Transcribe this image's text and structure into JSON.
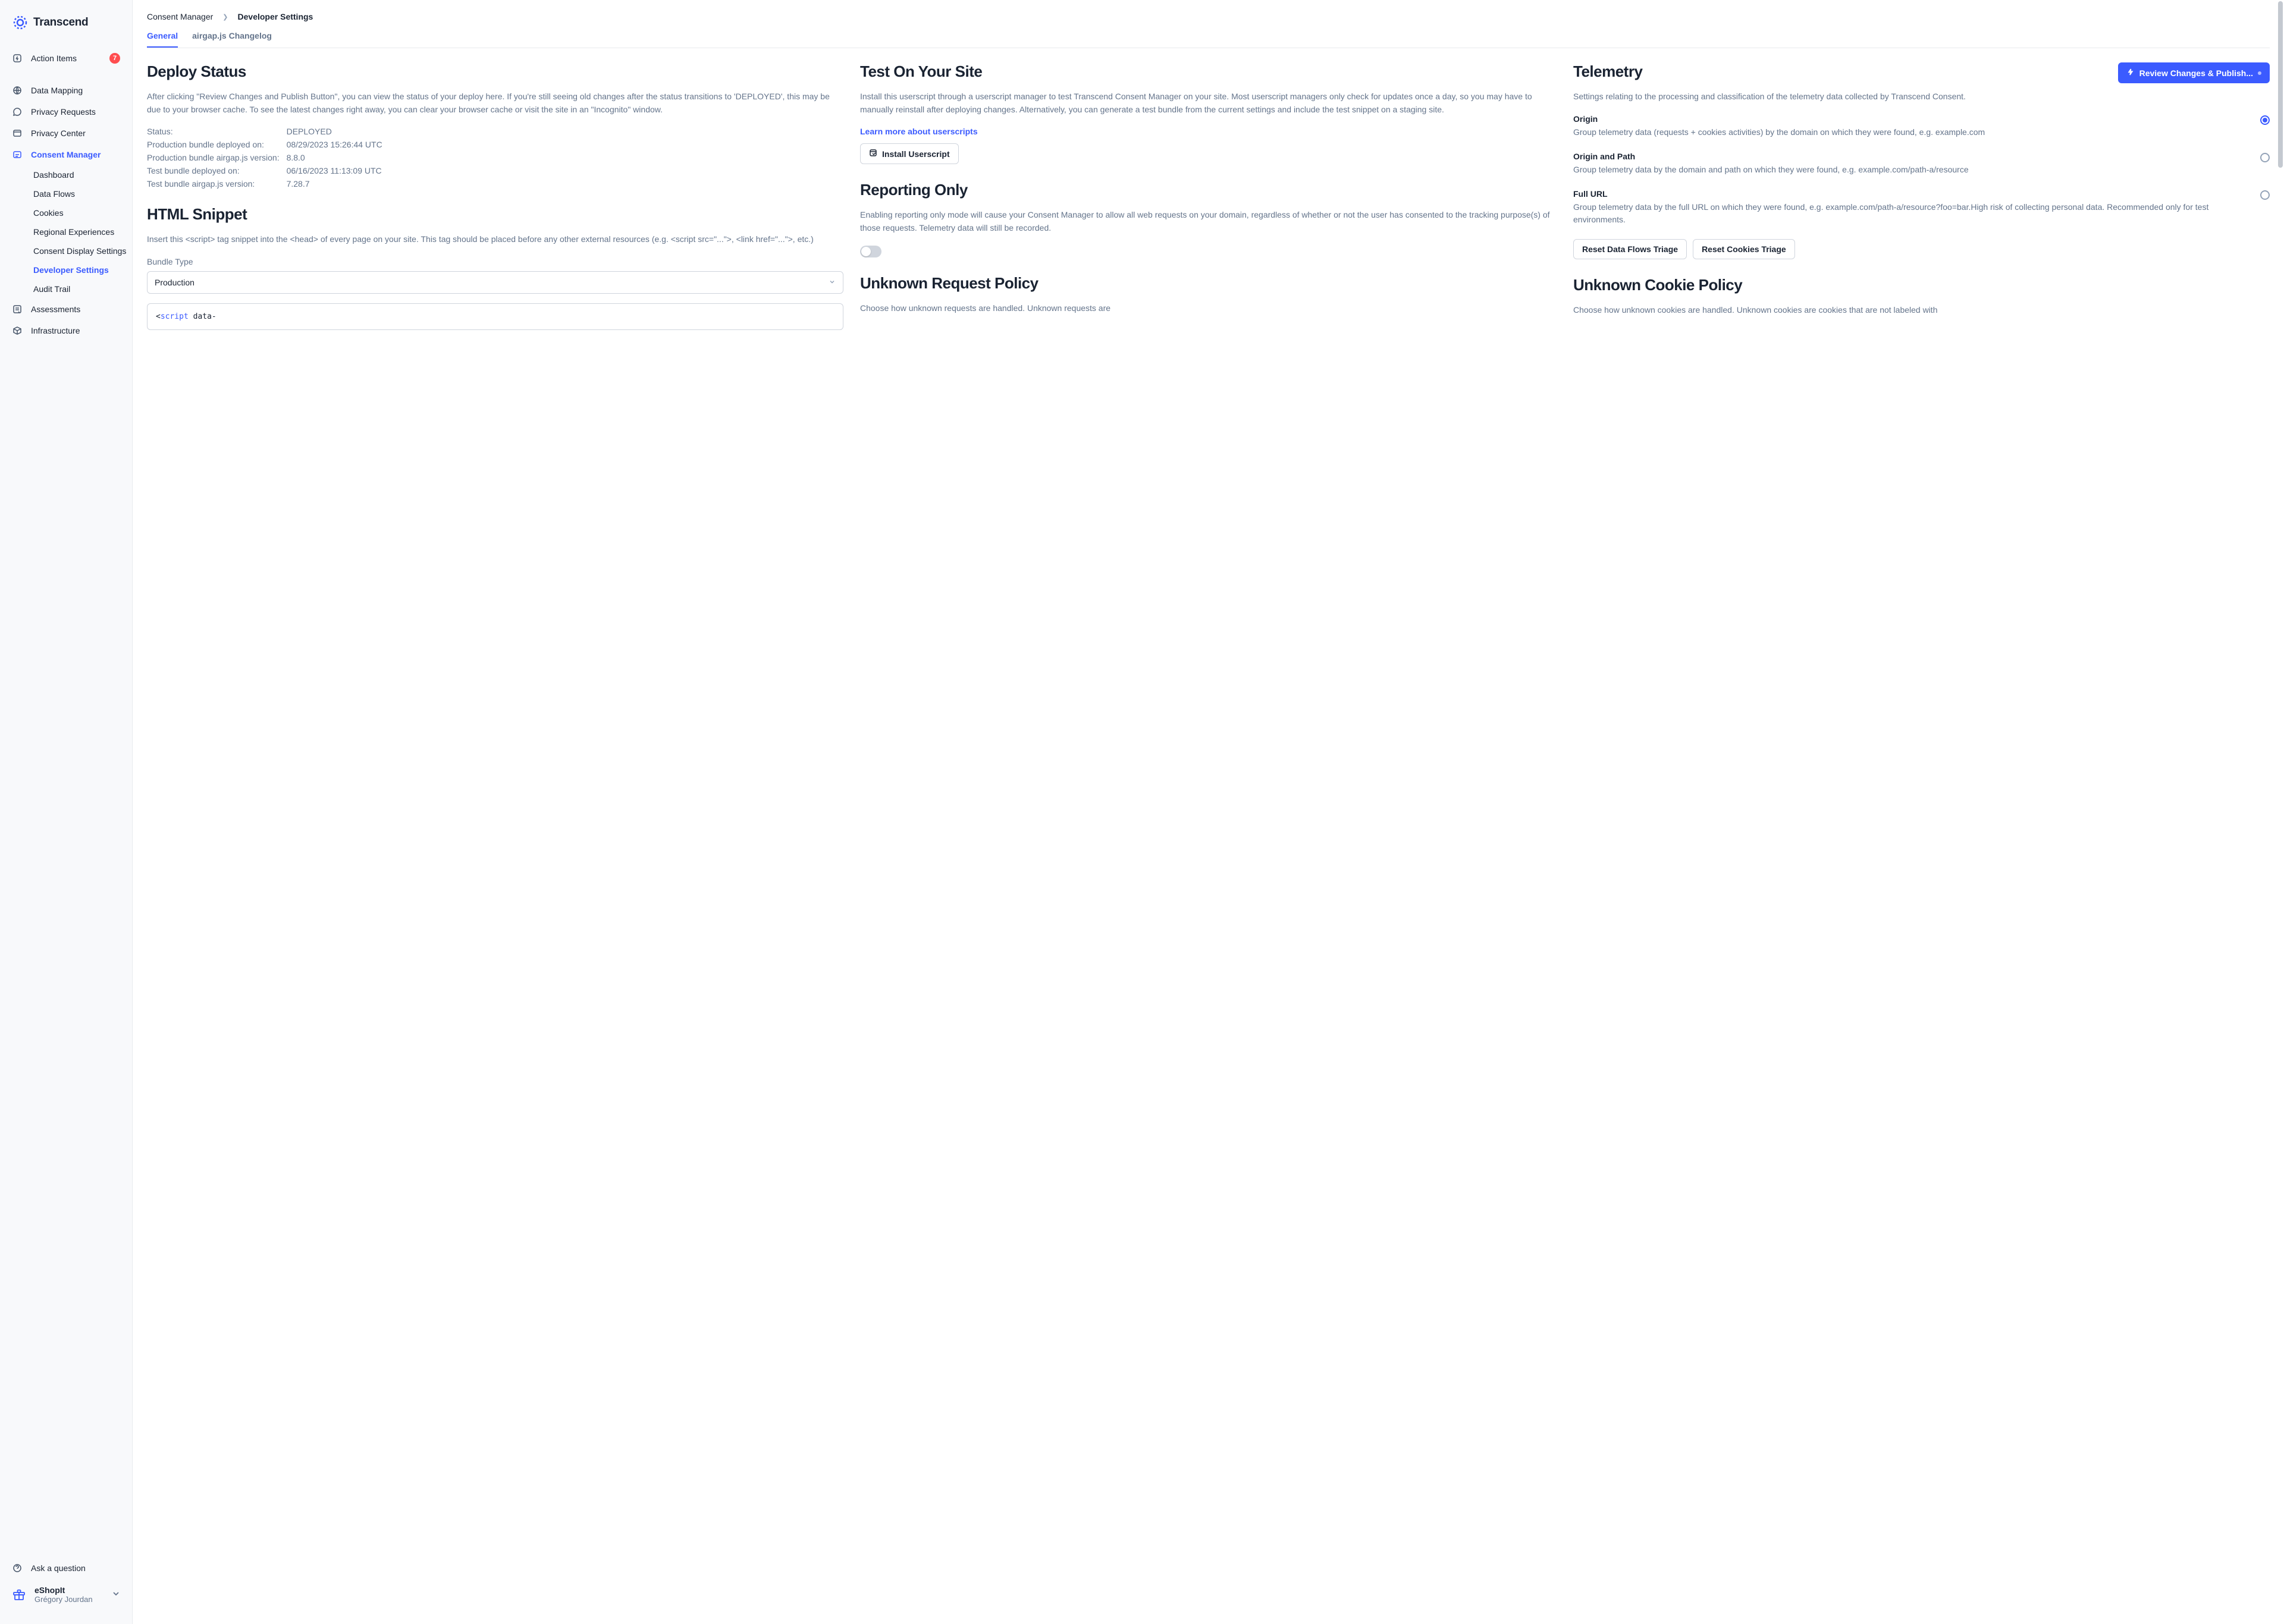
{
  "brand": "Transcend",
  "sidebar": {
    "items": [
      {
        "label": "Action Items",
        "badge": "7"
      },
      {
        "label": "Data Mapping"
      },
      {
        "label": "Privacy Requests"
      },
      {
        "label": "Privacy Center"
      },
      {
        "label": "Consent Manager",
        "active": true
      },
      {
        "label": "Assessments"
      },
      {
        "label": "Infrastructure"
      }
    ],
    "sub": [
      {
        "label": "Dashboard"
      },
      {
        "label": "Data Flows"
      },
      {
        "label": "Cookies"
      },
      {
        "label": "Regional Experiences"
      },
      {
        "label": "Consent Display Settings"
      },
      {
        "label": "Developer Settings",
        "active": true
      },
      {
        "label": "Audit Trail"
      }
    ],
    "ask": "Ask a question",
    "org": "eShopIt",
    "user": "Grégory Jourdan"
  },
  "breadcrumb": {
    "parent": "Consent Manager",
    "current": "Developer Settings"
  },
  "tabs": {
    "general": "General",
    "changelog": "airgap.js Changelog"
  },
  "publish": "Review Changes & Publish...",
  "deploy": {
    "title": "Deploy Status",
    "desc": "After clicking \"Review Changes and Publish Button\", you can view the status of your deploy here. If you're still seeing old changes after the status transitions to 'DEPLOYED', this may be due to your browser cache. To see the latest changes right away, you can clear your browser cache or visit the site in an \"Incognito\" window.",
    "status_k": "Status:",
    "status_v": "DEPLOYED",
    "prod_on_k": "Production bundle deployed on:",
    "prod_on_v": "08/29/2023 15:26:44 UTC",
    "prod_ver_k": "Production bundle airgap.js version:",
    "prod_ver_v": "8.8.0",
    "test_on_k": "Test bundle deployed on:",
    "test_on_v": "06/16/2023 11:13:09 UTC",
    "test_ver_k": "Test bundle airgap.js version:",
    "test_ver_v": "7.28.7"
  },
  "snippet": {
    "title": "HTML Snippet",
    "desc": "Insert this <script> tag snippet into the <head> of every page on your site. This tag should be placed before any other external resources (e.g. <script src=\"...\">, <link href=\"...\">, etc.)",
    "bundle_label": "Bundle Type",
    "bundle_value": "Production",
    "code_prefix": "<",
    "code_kw": "script",
    "code_rest": " data-"
  },
  "test": {
    "title": "Test On Your Site",
    "desc": "Install this userscript through a userscript manager to test Transcend Consent Manager on your site. Most userscript managers only check for updates once a day, so you may have to manually reinstall after deploying changes. Alternatively, you can generate a test bundle from the current settings and include the test snippet on a staging site.",
    "link": "Learn more about userscripts",
    "button": "Install Userscript"
  },
  "reporting": {
    "title": "Reporting Only",
    "desc": "Enabling reporting only mode will cause your Consent Manager to allow all web requests on your domain, regardless of whether or not the user has consented to the tracking purpose(s) of those requests. Telemetry data will still be recorded."
  },
  "unknown_req": {
    "title": "Unknown Request Policy",
    "desc": "Choose how unknown requests are handled. Unknown requests are"
  },
  "telemetry": {
    "title": "Telemetry",
    "desc": "Settings relating to the processing and classification of the telemetry data collected by Transcend Consent.",
    "opt1_label": "Origin",
    "opt1_desc": "Group telemetry data (requests + cookies activities) by the domain on which they were found, e.g. example.com",
    "opt2_label": "Origin and Path",
    "opt2_desc": "Group telemetry data by the domain and path on which they were found, e.g. example.com/path-a/resource",
    "opt3_label": "Full URL",
    "opt3_desc": "Group telemetry data by the full URL on which they were found, e.g. example.com/path-a/resource?foo=bar.High risk of collecting personal data. Recommended only for test environments.",
    "reset1": "Reset Data Flows Triage",
    "reset2": "Reset Cookies Triage"
  },
  "unknown_cookie": {
    "title": "Unknown Cookie Policy",
    "desc": "Choose how unknown cookies are handled. Unknown cookies are cookies that are not labeled with"
  }
}
